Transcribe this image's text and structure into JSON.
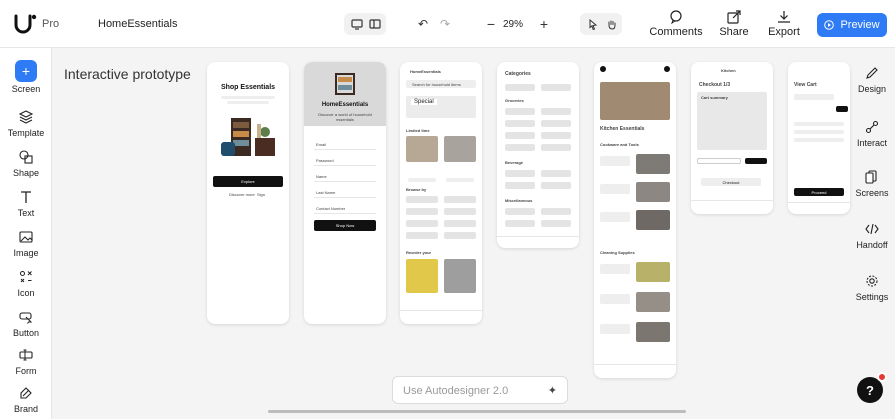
{
  "topbar": {
    "plan": "Pro",
    "project_name": "HomeEssentials",
    "zoom": "29%",
    "comments_label": "Comments",
    "share_label": "Share",
    "export_label": "Export",
    "preview_label": "Preview"
  },
  "leftbar": {
    "items": [
      {
        "label": "Screen"
      },
      {
        "label": "Template"
      },
      {
        "label": "Shape"
      },
      {
        "label": "Text"
      },
      {
        "label": "Image"
      },
      {
        "label": "Icon"
      },
      {
        "label": "Button"
      },
      {
        "label": "Form"
      },
      {
        "label": "Brand"
      }
    ]
  },
  "canvas": {
    "label": "Interactive prototype",
    "screens": {
      "s1": {
        "title": "Shop Essentials",
        "button": "Explore",
        "footer_a": "Discover more",
        "footer_b": "Sign"
      },
      "s2": {
        "title": "HomeEssentials",
        "subtitle": "Discover a world of household essentials",
        "fields": [
          "Email",
          "Password",
          "Name",
          "Last Name",
          "Contact Number"
        ],
        "button": "Shop Now"
      },
      "s3": {
        "header": "HomeEssentials",
        "search": "Search for household items",
        "special": "Special",
        "limited": "Limited time",
        "browse": "Browse by",
        "reorder": "Reorder your"
      },
      "s4": {
        "title": "Categories",
        "groups": [
          "Groceries",
          "Beverage",
          "Miscellaneous"
        ]
      },
      "s5": {
        "title": "Kitchen Essentials",
        "section_a": "Cookware and Tools",
        "section_b": "Cleaning Supplies"
      },
      "s6": {
        "header": "Kitchen",
        "title": "Checkout 1/3",
        "summary": "Cart summary",
        "button": "Checkout"
      },
      "s7": {
        "title": "View Cart",
        "button": "Proceed"
      }
    }
  },
  "rightbar": {
    "items": [
      {
        "label": "Design"
      },
      {
        "label": "Interact"
      },
      {
        "label": "Screens"
      },
      {
        "label": "Handoff"
      },
      {
        "label": "Settings"
      }
    ]
  },
  "bottom": {
    "autodesigner_placeholder": "Use Autodesigner 2.0",
    "help": "?"
  },
  "colors": {
    "accent": "#2f7bf5",
    "canvas_bg": "#f4f4f4",
    "badge": "#e53935"
  }
}
